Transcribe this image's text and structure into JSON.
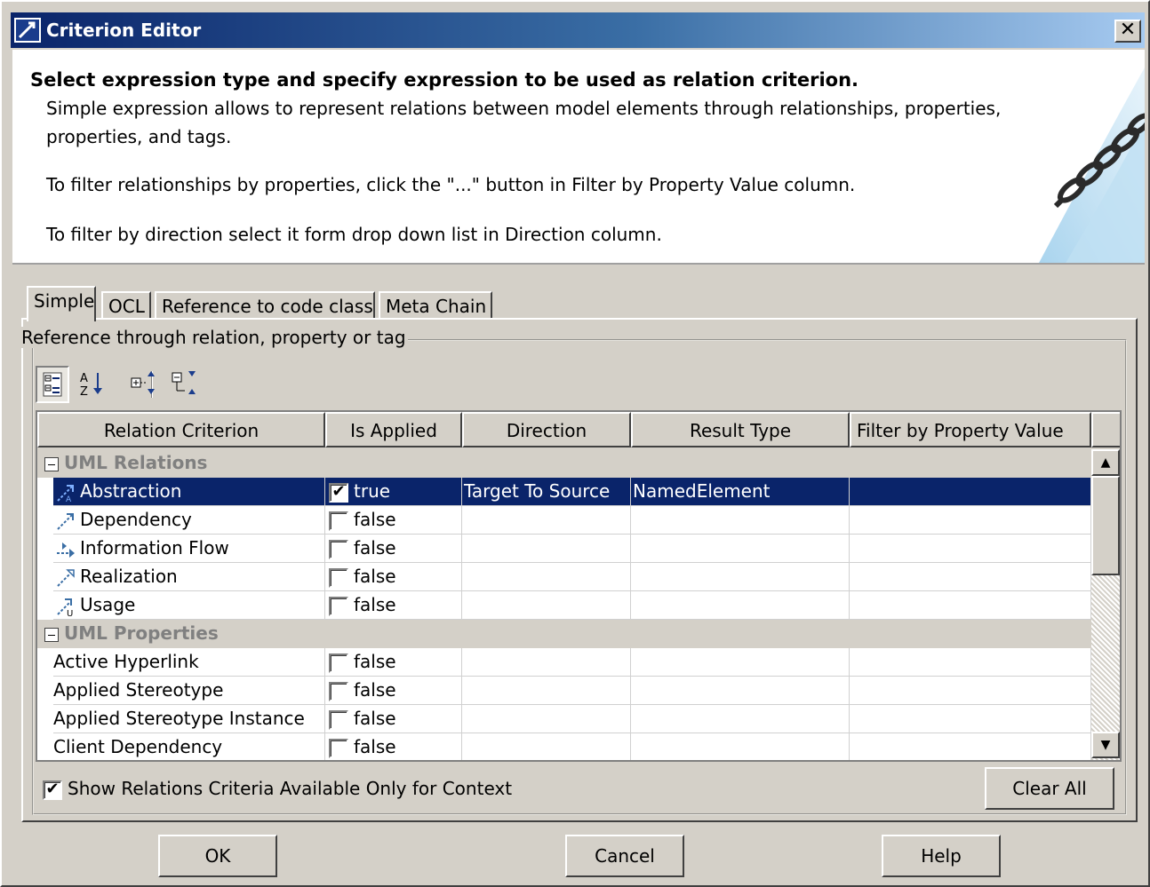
{
  "window": {
    "title": "Criterion Editor",
    "close_label": "✕"
  },
  "header": {
    "heading": "Select expression type and specify expression to be used as relation criterion.",
    "line1": "Simple expression allows to represent relations between model elements through relationships, properties,",
    "line2": "properties, and  tags.",
    "line3": "To filter relationships by properties, click the \"...\" button in Filter by Property Value column.",
    "line4": "To filter by direction select it form drop down list in Direction column.",
    "art_icon": "chain-icon"
  },
  "tabs": [
    {
      "label": "Simple",
      "active": true
    },
    {
      "label": "OCL"
    },
    {
      "label": "Reference to code class"
    },
    {
      "label": "Meta Chain"
    }
  ],
  "group_label": "Reference through relation, property or tag",
  "toolbar": {
    "buttons": [
      {
        "name": "categorized-view-icon",
        "pressed": true
      },
      {
        "name": "sort-alphabetically-icon"
      },
      {
        "name": "expand-all-icon"
      },
      {
        "name": "collapse-all-icon"
      }
    ]
  },
  "table": {
    "columns": [
      "Relation Criterion",
      "Is Applied",
      "Direction",
      "Result Type",
      "Filter by Property Value"
    ],
    "groups": [
      {
        "title": "UML Relations",
        "rows": [
          {
            "name": "Abstraction",
            "icon": "abstraction-icon",
            "applied": "true",
            "checked": true,
            "direction": "Target To Source",
            "result": "NamedElement",
            "filter": "",
            "selected": true
          },
          {
            "name": "Dependency",
            "icon": "dependency-icon",
            "applied": "false",
            "checked": false,
            "direction": "",
            "result": "",
            "filter": ""
          },
          {
            "name": "Information Flow",
            "icon": "information-flow-icon",
            "applied": "false",
            "checked": false,
            "direction": "",
            "result": "",
            "filter": ""
          },
          {
            "name": "Realization",
            "icon": "realization-icon",
            "applied": "false",
            "checked": false,
            "direction": "",
            "result": "",
            "filter": ""
          },
          {
            "name": "Usage",
            "icon": "usage-icon",
            "applied": "false",
            "checked": false,
            "direction": "",
            "result": "",
            "filter": ""
          }
        ]
      },
      {
        "title": "UML Properties",
        "rows": [
          {
            "name": "Active Hyperlink",
            "applied": "false",
            "checked": false,
            "direction": "",
            "result": "",
            "filter": ""
          },
          {
            "name": "Applied Stereotype",
            "applied": "false",
            "checked": false,
            "direction": "",
            "result": "",
            "filter": ""
          },
          {
            "name": "Applied Stereotype Instance",
            "applied": "false",
            "checked": false,
            "direction": "",
            "result": "",
            "filter": ""
          },
          {
            "name": "Client Dependency",
            "applied": "false",
            "checked": false,
            "direction": "",
            "result": "",
            "filter": ""
          }
        ]
      }
    ]
  },
  "show_only_context": {
    "label": "Show Relations Criteria Available Only for Context",
    "checked": true
  },
  "buttons": {
    "clear_all": "Clear All",
    "ok": "OK",
    "cancel": "Cancel",
    "help": "Help"
  }
}
